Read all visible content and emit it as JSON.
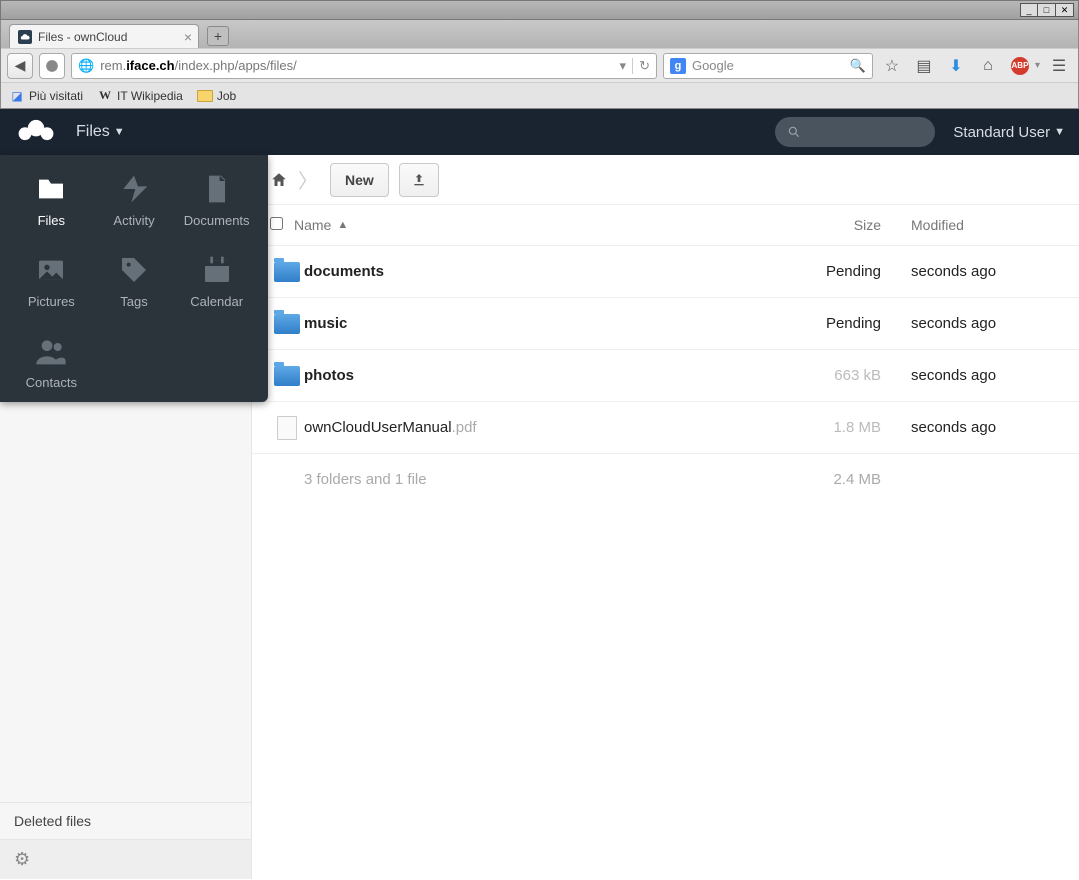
{
  "window": {
    "tab_title": "Files - ownCloud"
  },
  "browser": {
    "url_prefix": "rem.",
    "url_bold": "iface.ch",
    "url_suffix": "/index.php/apps/files/",
    "search_placeholder": "Google",
    "bookmarks": [
      {
        "label": "Più visitati",
        "icon": "most-visited"
      },
      {
        "label": "IT Wikipedia",
        "icon": "wiki"
      },
      {
        "label": "Job",
        "icon": "folder"
      }
    ]
  },
  "oc": {
    "app_label": "Files",
    "user_label": "Standard User",
    "apps": [
      {
        "label": "Files",
        "icon": "files",
        "active": true
      },
      {
        "label": "Activity",
        "icon": "activity"
      },
      {
        "label": "Documents",
        "icon": "documents"
      },
      {
        "label": "Pictures",
        "icon": "pictures"
      },
      {
        "label": "Tags",
        "icon": "tags"
      },
      {
        "label": "Calendar",
        "icon": "calendar"
      },
      {
        "label": "Contacts",
        "icon": "contacts"
      }
    ],
    "sidebar_deleted": "Deleted files",
    "controls": {
      "new_label": "New"
    },
    "headers": {
      "name": "Name",
      "size": "Size",
      "modified": "Modified"
    },
    "rows": [
      {
        "type": "folder",
        "name": "documents",
        "ext": "",
        "size": "Pending",
        "size_style": "pending",
        "modified": "seconds ago"
      },
      {
        "type": "folder",
        "name": "music",
        "ext": "",
        "size": "Pending",
        "size_style": "pending",
        "modified": "seconds ago"
      },
      {
        "type": "folder",
        "name": "photos",
        "ext": "",
        "size": "663 kB",
        "size_style": "dim",
        "modified": "seconds ago"
      },
      {
        "type": "file",
        "name": "ownCloudUserManual",
        "ext": ".pdf",
        "size": "1.8 MB",
        "size_style": "dim",
        "modified": "seconds ago"
      }
    ],
    "summary": {
      "text": "3 folders and 1 file",
      "size": "2.4 MB"
    }
  }
}
